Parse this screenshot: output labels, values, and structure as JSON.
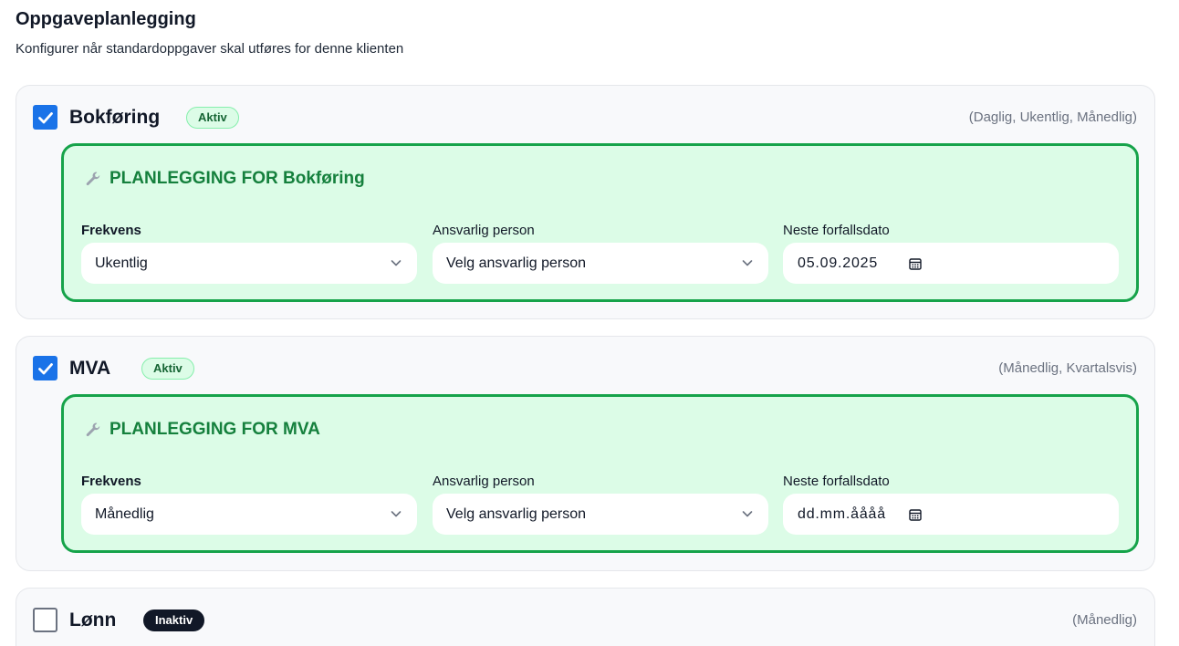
{
  "page": {
    "title": "Oppgaveplanlegging",
    "subtitle": "Konfigurer når standardoppgaver skal utføres for denne klienten"
  },
  "tasks": [
    {
      "name": "Bokføring",
      "checked": true,
      "badge": "Aktiv",
      "frequencies": "(Daglig, Ukentlig, Månedlig)",
      "planning": {
        "title": "PLANLEGGING FOR Bokføring",
        "frequency_label": "Frekvens",
        "frequency_value": "Ukentlig",
        "person_label": "Ansvarlig person",
        "person_value": "Velg ansvarlig person",
        "date_label": "Neste forfallsdato",
        "date_value": "05.09.2025"
      }
    },
    {
      "name": "MVA",
      "checked": true,
      "badge": "Aktiv",
      "frequencies": "(Månedlig, Kvartalsvis)",
      "planning": {
        "title": "PLANLEGGING FOR MVA",
        "frequency_label": "Frekvens",
        "frequency_value": "Månedlig",
        "person_label": "Ansvarlig person",
        "person_value": "Velg ansvarlig person",
        "date_label": "Neste forfallsdato",
        "date_value": "dd.mm.åååå"
      }
    },
    {
      "name": "Lønn",
      "checked": false,
      "badge": "Inaktiv",
      "frequencies": "(Månedlig)"
    }
  ],
  "icons": {
    "checkbox_checked": "check-icon",
    "planning": "wrench-icon",
    "select": "chevron-down-icon",
    "date": "calendar-icon"
  },
  "colors": {
    "accent_blue": "#1a73e8",
    "active_green": "#16a34a",
    "active_bg": "#dcfce7",
    "inactive_badge": "#111827"
  }
}
